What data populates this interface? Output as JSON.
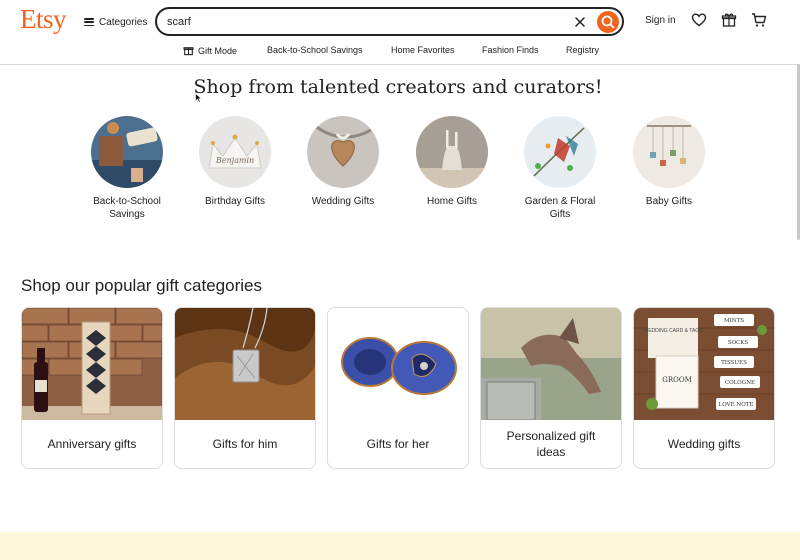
{
  "header": {
    "logo": "Etsy",
    "categories_label": "Categories",
    "search_value": "scarf",
    "sign_in": "Sign in"
  },
  "subnav": {
    "items": [
      "Gift Mode",
      "Back-to-School Savings",
      "Home Favorites",
      "Fashion Finds",
      "Registry"
    ]
  },
  "hero": {
    "title": "Shop from talented creators and curators!",
    "circles": [
      {
        "label": "Back-to-School Savings"
      },
      {
        "label": "Birthday Gifts"
      },
      {
        "label": "Wedding Gifts"
      },
      {
        "label": "Home Gifts"
      },
      {
        "label": "Garden & Floral Gifts"
      },
      {
        "label": "Baby Gifts"
      }
    ],
    "birthday_crown_text": "Benjamin"
  },
  "popular": {
    "title": "Shop our popular gift categories",
    "cards": [
      {
        "label": "Anniversary gifts"
      },
      {
        "label": "Gifts for him"
      },
      {
        "label": "Gifts for her"
      },
      {
        "label": "Personalized gift ideas"
      },
      {
        "label": "Wedding gifts"
      }
    ],
    "wedding_tags": [
      "MINTS",
      "SOCKS",
      "TISSUES",
      "COLOGNE",
      "LOVE NOTE"
    ],
    "wedding_card_title": "WEDDING CARD & TAGS",
    "wedding_card_groom": "GROOM"
  },
  "colors": {
    "brand": "#f1641e",
    "footer_band": "#fdf8dc",
    "text": "#222222"
  }
}
